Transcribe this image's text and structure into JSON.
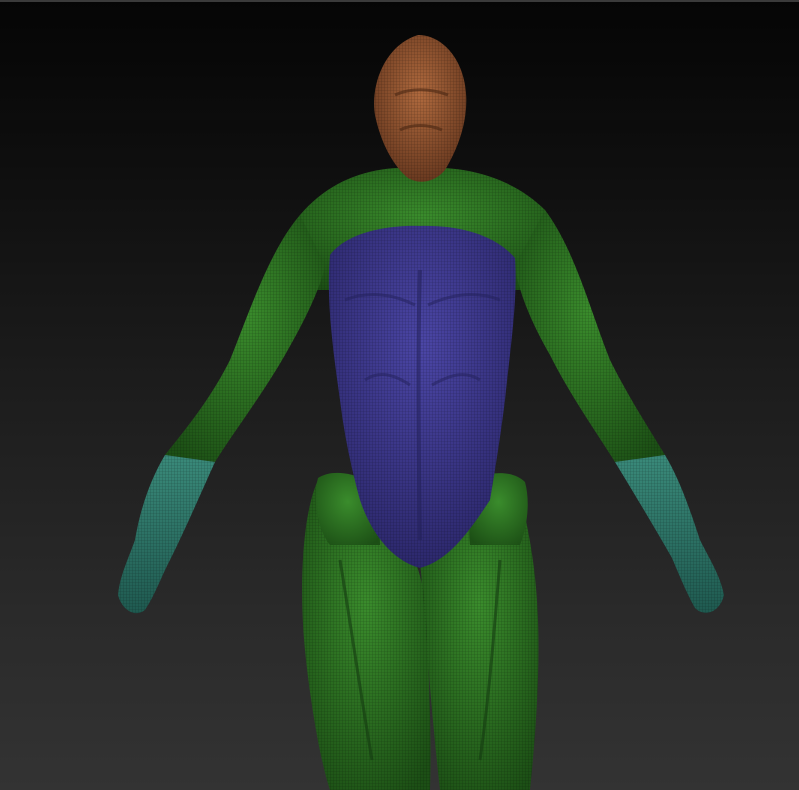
{
  "viewport": {
    "background_top": "#050505",
    "background_bottom": "#333333"
  },
  "model": {
    "polygroups": [
      {
        "name": "head",
        "color": "#9a5a35"
      },
      {
        "name": "body-limbs",
        "color": "#2f7a24"
      },
      {
        "name": "torso",
        "color": "#3f3a90"
      },
      {
        "name": "forearms-hands",
        "color": "#2f7a6a"
      }
    ],
    "wireframe_overlay": true
  }
}
